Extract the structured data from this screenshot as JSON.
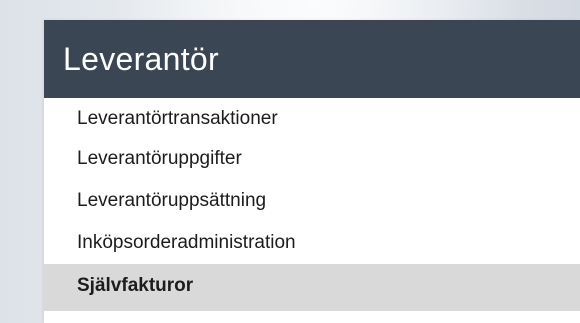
{
  "panel": {
    "title": "Leverantör",
    "colors": {
      "header_bg": "#3b4654",
      "header_text": "#ffffff",
      "active_item_bg": "#d9d9d9"
    },
    "items": [
      {
        "label": "Leverantörtransaktioner",
        "active": false
      },
      {
        "label": "Leverantöruppgifter",
        "active": false
      },
      {
        "label": "Leverantöruppsättning",
        "active": false
      },
      {
        "label": "Inköpsorderadministration",
        "active": false
      },
      {
        "label": "Självfakturor",
        "active": true
      }
    ]
  }
}
